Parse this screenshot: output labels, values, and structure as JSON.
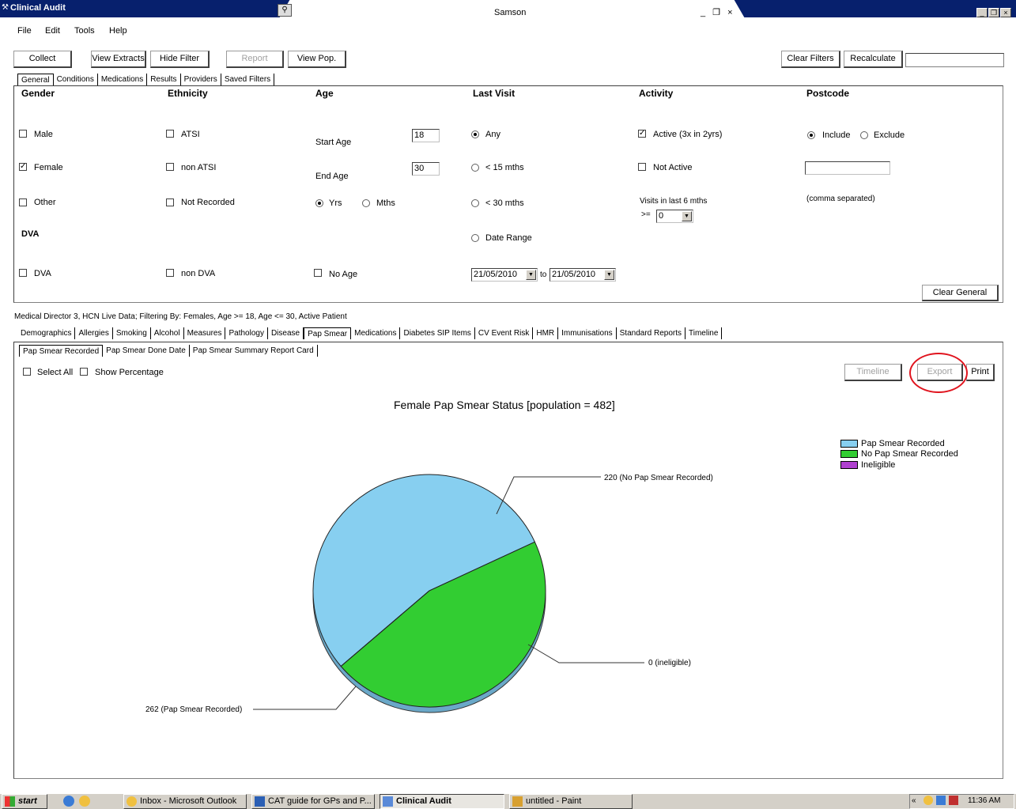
{
  "window": {
    "title": "Clinical Audit",
    "mdi_title": "Samson",
    "mdi_controls": "_ ❐ ×",
    "win_controls": [
      "_",
      "❐",
      "×"
    ]
  },
  "menu": [
    "File",
    "Edit",
    "Tools",
    "Help"
  ],
  "toolbar": {
    "collect": "Collect",
    "view_extracts": "View Extracts",
    "hide_filter": "Hide Filter",
    "report": "Report",
    "view_pop": "View Pop.",
    "clear_filters": "Clear Filters",
    "recalculate": "Recalculate",
    "search_value": ""
  },
  "filter_tabs": [
    "General",
    "Conditions",
    "Medications",
    "Results",
    "Providers",
    "Saved Filters"
  ],
  "filter": {
    "gender": {
      "header": "Gender",
      "male": "Male",
      "male_checked": false,
      "female": "Female",
      "female_checked": true,
      "other": "Other",
      "other_checked": false
    },
    "dva": {
      "header": "DVA",
      "label": "DVA",
      "checked": false
    },
    "ethnicity": {
      "header": "Ethnicity",
      "atsi": "ATSI",
      "non_atsi": "non ATSI",
      "not_recorded": "Not Recorded",
      "non_dva": "non DVA"
    },
    "age": {
      "header": "Age",
      "start_label": "Start Age",
      "start_value": "18",
      "end_label": "End Age",
      "end_value": "30",
      "yrs": "Yrs",
      "mths": "Mths",
      "no_age": "No Age"
    },
    "last_visit": {
      "header": "Last Visit",
      "any": "Any",
      "lt15": "< 15 mths",
      "lt30": "< 30 mths",
      "date_range": "Date Range",
      "from": "21/05/2010",
      "to_label": "to",
      "to": "21/05/2010"
    },
    "activity": {
      "header": "Activity",
      "active": "Active (3x in 2yrs)",
      "active_checked": true,
      "not_active": "Not Active",
      "not_active_checked": false,
      "visits_label": "Visits in last 6 mths",
      "visits_op": ">=",
      "visits_value": "0"
    },
    "postcode": {
      "header": "Postcode",
      "include": "Include",
      "exclude": "Exclude",
      "value": "",
      "hint": "(comma separated)"
    },
    "clear_general": "Clear General"
  },
  "status_line": "Medical Director 3, HCN Live Data; Filtering By: Females, Age >= 18, Age <= 30, Active Patient",
  "report_tabs": [
    "Demographics",
    "Allergies",
    "Smoking",
    "Alcohol",
    "Measures",
    "Pathology",
    "Disease",
    "Pap Smear",
    "Medications",
    "Diabetes SIP Items",
    "CV Event Risk",
    "HMR",
    "Immunisations",
    "Standard Reports",
    "Timeline"
  ],
  "sub_tabs": [
    "Pap Smear Recorded",
    "Pap Smear Done Date",
    "Pap Smear Summary Report Card"
  ],
  "chart_controls": {
    "select_all": "Select All",
    "show_percentage": "Show Percentage",
    "timeline": "Timeline",
    "export": "Export",
    "print": "Print"
  },
  "colors": {
    "recorded": "#87cff0",
    "no_recorded": "#32cd32",
    "ineligible": "#b040d0",
    "highlight": "#e0141e"
  },
  "chart_data": {
    "type": "pie",
    "title": "Female Pap Smear Status [population = 482]",
    "slices": [
      {
        "label": "Pap Smear Recorded",
        "value": 262,
        "callout": "262 (Pap Smear Recorded)"
      },
      {
        "label": "No Pap Smear Recorded",
        "value": 220,
        "callout": "220 (No Pap Smear Recorded)"
      },
      {
        "label": "Ineligible",
        "value": 0,
        "callout": "0 (ineligible)"
      }
    ],
    "legend": [
      "Pap Smear Recorded",
      "No Pap Smear Recorded",
      "Ineligible"
    ],
    "legend_position": "top-right"
  },
  "taskbar": {
    "start": "start",
    "tasks": [
      "Inbox - Microsoft Outlook",
      "CAT guide for GPs and P...",
      "Clinical Audit",
      "untitled - Paint"
    ],
    "clock": "11:36 AM"
  }
}
